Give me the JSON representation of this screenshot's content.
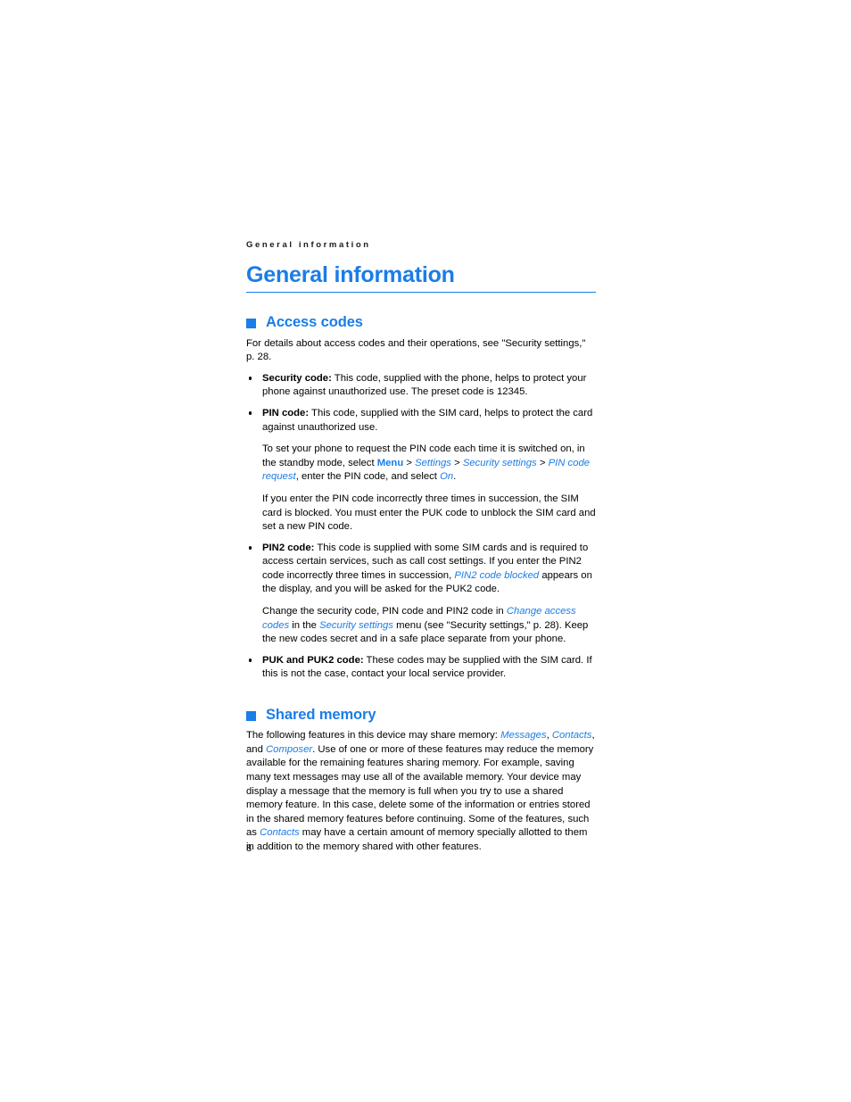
{
  "page": {
    "running_header": "General information",
    "chapter_title": "General information",
    "folio": "8"
  },
  "sections": [
    {
      "id": "access-codes",
      "title": "Access codes",
      "bullet_icon": "square-bullet-icon",
      "lead": "For details about access codes and their operations, see \"Security settings,\" p. 28.",
      "items": [
        {
          "term": "Security code:",
          "text": " This code, supplied with the phone, helps to protect your phone against unauthorized use. The preset code is 12345."
        },
        {
          "term": "PIN code:",
          "text": " This code, supplied with the SIM card, helps to protect the card against unauthorized use.",
          "sub_paragraphs": [
            {
              "segments": [
                {
                  "style": "plain",
                  "text": "To set your phone to request the PIN code each time it is switched on, in the standby mode, select "
                },
                {
                  "style": "ui-bold",
                  "text": "Menu"
                },
                {
                  "style": "plain",
                  "text": " > "
                },
                {
                  "style": "ui-italic",
                  "text": "Settings"
                },
                {
                  "style": "plain",
                  "text": " > "
                },
                {
                  "style": "ui-italic",
                  "text": "Security settings"
                },
                {
                  "style": "plain",
                  "text": " > "
                },
                {
                  "style": "ui-italic",
                  "text": "PIN code request"
                },
                {
                  "style": "plain",
                  "text": ", enter the PIN code, and select "
                },
                {
                  "style": "ui-italic",
                  "text": "On"
                },
                {
                  "style": "plain",
                  "text": "."
                }
              ]
            },
            {
              "segments": [
                {
                  "style": "plain",
                  "text": "If you enter the PIN code incorrectly three times in succession, the SIM card is blocked. You must enter the PUK code to unblock the SIM card and set a new PIN code."
                }
              ]
            }
          ]
        },
        {
          "term": "PIN2 code:",
          "segments": [
            {
              "style": "plain",
              "text": " This code is supplied with some SIM cards and is required to access certain services, such as call cost settings. If you enter the PIN2 code incorrectly three times in succession, "
            },
            {
              "style": "ui-italic",
              "text": "PIN2 code blocked"
            },
            {
              "style": "plain",
              "text": " appears on the display, and you will be asked for the PUK2 code."
            }
          ],
          "sub_paragraphs": [
            {
              "segments": [
                {
                  "style": "plain",
                  "text": "Change the security code, PIN code and PIN2 code in "
                },
                {
                  "style": "ui-italic",
                  "text": "Change access codes"
                },
                {
                  "style": "plain",
                  "text": " in the "
                },
                {
                  "style": "ui-italic",
                  "text": "Security settings"
                },
                {
                  "style": "plain",
                  "text": " menu (see \"Security settings,\" p. 28). Keep the new codes secret and in a safe place separate from your phone."
                }
              ]
            }
          ]
        },
        {
          "term": "PUK and PUK2 code:",
          "text": " These codes may be supplied with the SIM card. If this is not the case, contact your local service provider."
        }
      ]
    },
    {
      "id": "shared-memory",
      "title": "Shared memory",
      "bullet_icon": "square-bullet-icon",
      "body_segments": [
        {
          "style": "plain",
          "text": "The following features in this device may share memory: "
        },
        {
          "style": "ui-italic",
          "text": "Messages"
        },
        {
          "style": "plain",
          "text": ", "
        },
        {
          "style": "ui-italic",
          "text": "Contacts"
        },
        {
          "style": "plain",
          "text": ", and "
        },
        {
          "style": "ui-italic",
          "text": "Composer"
        },
        {
          "style": "plain",
          "text": ". Use of one or more of these features may reduce the memory available for the remaining features sharing memory. For example, saving many text messages may use all of the available memory. Your device may display a message that the memory is full when you try to use a shared memory feature. In this case, delete some of the information or entries stored in the shared memory features before continuing. Some of the features, such as "
        },
        {
          "style": "ui-italic",
          "text": "Contacts"
        },
        {
          "style": "plain",
          "text": " may have a certain amount of memory specially allotted to them in addition to the memory shared with other features."
        }
      ]
    }
  ],
  "colors": {
    "accent_blue": "#1a7de8",
    "body_black": "#000000",
    "page_background": "#ffffff"
  }
}
